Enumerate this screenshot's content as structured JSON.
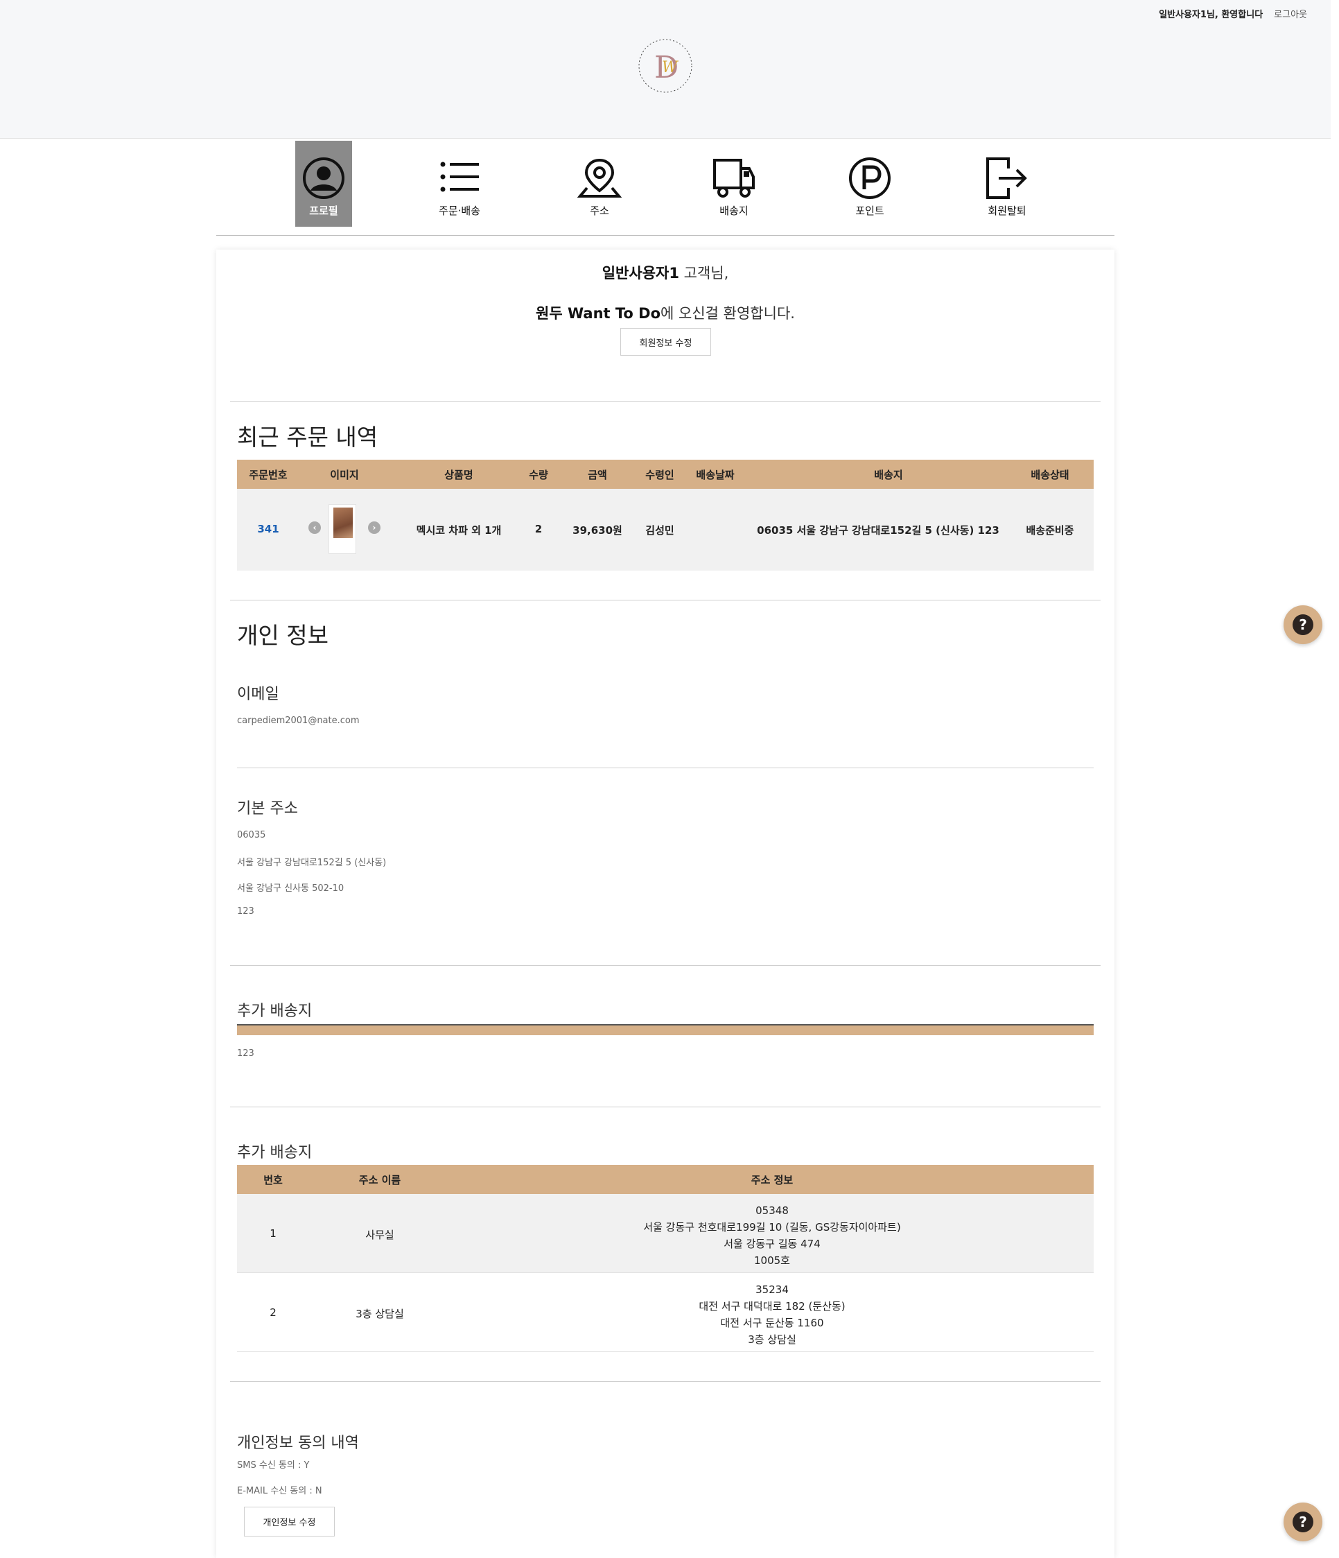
{
  "header": {
    "welcome": "일반사용자1님, 환영합니다",
    "logout": "로그아웃"
  },
  "nav": {
    "items": [
      {
        "label": "프로필",
        "icon": "profile-icon"
      },
      {
        "label": "주문·배송",
        "icon": "list-icon"
      },
      {
        "label": "주소",
        "icon": "location-pin-icon"
      },
      {
        "label": "배송지",
        "icon": "truck-icon"
      },
      {
        "label": "포인트",
        "icon": "point-icon"
      },
      {
        "label": "회원탈퇴",
        "icon": "exit-icon"
      }
    ]
  },
  "greeting": {
    "name": "일반사용자1",
    "suffix": " 고객님,",
    "brand": "원두 Want To Do",
    "message": "에 오신걸 환영합니다.",
    "edit_button": "회원정보 수정"
  },
  "orders": {
    "title": "최근 주문 내역",
    "headers": [
      "주문번호",
      "이미지",
      "상품명",
      "수량",
      "금액",
      "수령인",
      "배송날짜",
      "배송지",
      "배송상태"
    ],
    "rows": [
      {
        "num": "341",
        "product": "멕시코 차파 외 1개",
        "qty": "2",
        "price": "39,630원",
        "recipient": "김성민",
        "date": "",
        "address": "06035 서울 강남구 강남대로152길 5 (신사동) 123",
        "status": "배송준비중"
      }
    ]
  },
  "personal": {
    "title": "개인 정보",
    "email_label": "이메일",
    "email": "carpediem2001@nate.com",
    "addr_label": "기본 주소",
    "zip": "06035",
    "road": "서울 강남구 강남대로152길 5 (신사동)",
    "jibun": "서울 강남구 신사동 502-10",
    "detail": "123"
  },
  "extra1": {
    "title": "추가 배송지",
    "detail": "123"
  },
  "extra2": {
    "title": "추가 배송지",
    "headers": [
      "번호",
      "주소 이름",
      "주소 정보"
    ],
    "rows": [
      {
        "no": "1",
        "name": "사무실",
        "zip": "05348",
        "road": "서울 강동구 천호대로199길 10 (길동, GS강동자이아파트)",
        "jibun": "서울 강동구 길동 474",
        "detail": "1005호"
      },
      {
        "no": "2",
        "name": "3층 상담실",
        "zip": "35234",
        "road": "대전 서구 대덕대로 182 (둔산동)",
        "jibun": "대전 서구 둔산동 1160",
        "detail": "3층 상담실"
      }
    ]
  },
  "consent": {
    "title": "개인정보 동의 내역",
    "sms": "SMS 수신 동의 : Y",
    "email": "E-MAIL 수신 동의 : N",
    "edit_button": "개인정보 수정"
  },
  "colors": {
    "accent": "#d6b088",
    "active_nav": "#8a8a8a",
    "link": "#1a5fb4"
  }
}
